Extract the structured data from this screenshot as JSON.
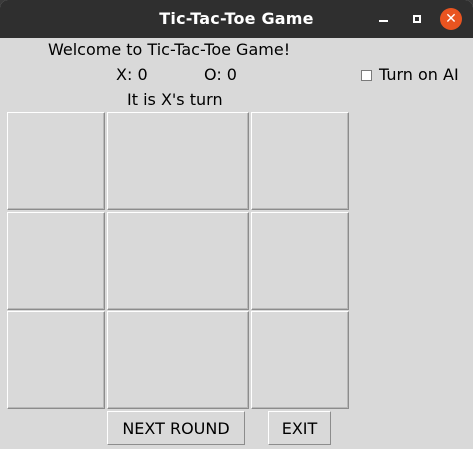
{
  "window": {
    "title": "Tic-Tac-Toe Game",
    "controls": [
      "minimize-icon",
      "maximize-icon",
      "close-icon"
    ],
    "close_color": "#e95420"
  },
  "game": {
    "welcome": "Welcome to Tic-Tac-Toe Game!",
    "score_x": "X: 0",
    "score_o": "O: 0",
    "turn": "It is X's turn",
    "ai_label": "Turn on AI",
    "ai_enabled": false
  },
  "board": {
    "cells": [
      "",
      "",
      "",
      "",
      "",
      "",
      "",
      "",
      ""
    ]
  },
  "buttons": {
    "next_round": "NEXT ROUND",
    "exit": "EXIT"
  }
}
